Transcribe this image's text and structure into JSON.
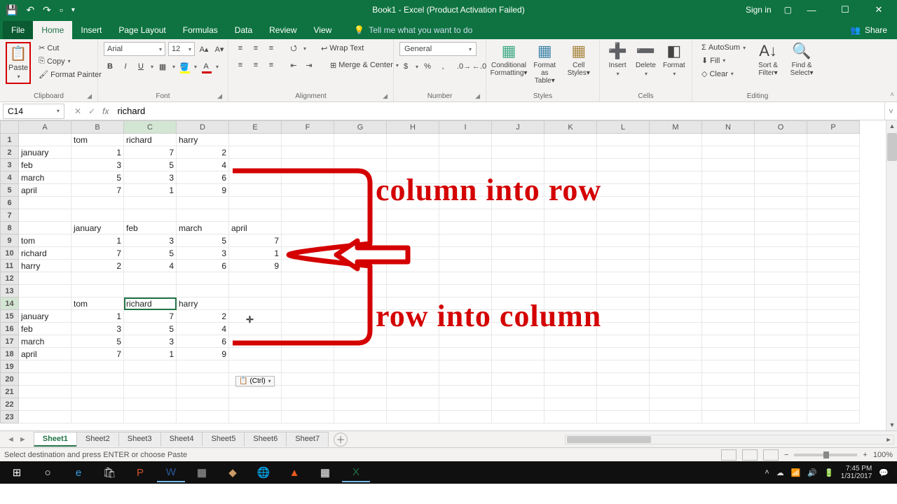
{
  "title": "Book1  -  Excel (Product Activation Failed)",
  "signin": "Sign in",
  "tabs": {
    "file": "File",
    "home": "Home",
    "insert": "Insert",
    "pagelayout": "Page Layout",
    "formulas": "Formulas",
    "data": "Data",
    "review": "Review",
    "view": "View",
    "tellme": "Tell me what you want to do",
    "share": "Share"
  },
  "ribbon": {
    "clipboard": {
      "paste": "Paste",
      "cut": "Cut",
      "copy": "Copy",
      "fmtpainter": "Format Painter",
      "label": "Clipboard"
    },
    "font": {
      "name": "Arial",
      "size": "12",
      "b": "B",
      "i": "I",
      "u": "U",
      "label": "Font"
    },
    "alignment": {
      "wrap": "Wrap Text",
      "merge": "Merge & Center",
      "label": "Alignment"
    },
    "number": {
      "fmt": "General",
      "label": "Number"
    },
    "styles": {
      "cond": "Conditional Formatting",
      "table": "Format as Table",
      "cell": "Cell Styles",
      "label": "Styles"
    },
    "cells": {
      "insert": "Insert",
      "delete": "Delete",
      "format": "Format",
      "label": "Cells"
    },
    "editing": {
      "sum": "AutoSum",
      "fill": "Fill",
      "clear": "Clear",
      "sort": "Sort & Filter",
      "find": "Find & Select",
      "label": "Editing"
    }
  },
  "namebox": "C14",
  "formula": "richard",
  "columns": [
    "A",
    "B",
    "C",
    "D",
    "E",
    "F",
    "G",
    "H",
    "I",
    "J",
    "K",
    "L",
    "M",
    "N",
    "O",
    "P"
  ],
  "cells": {
    "r1": {
      "B": "tom",
      "C": "richard",
      "D": "harry"
    },
    "r2": {
      "A": "january",
      "B": "1",
      "C": "7",
      "D": "2"
    },
    "r3": {
      "A": "feb",
      "B": "3",
      "C": "5",
      "D": "4"
    },
    "r4": {
      "A": "march",
      "B": "5",
      "C": "3",
      "D": "6"
    },
    "r5": {
      "A": "april",
      "B": "7",
      "C": "1",
      "D": "9"
    },
    "r8": {
      "B": "january",
      "C": "feb",
      "D": "march",
      "E": "april"
    },
    "r9": {
      "A": "tom",
      "B": "1",
      "C": "3",
      "D": "5",
      "E": "7"
    },
    "r10": {
      "A": "richard",
      "B": "7",
      "C": "5",
      "D": "3",
      "E": "1"
    },
    "r11": {
      "A": "harry",
      "B": "2",
      "C": "4",
      "D": "6",
      "E": "9"
    },
    "r14": {
      "B": "tom",
      "C": "richard",
      "D": "harry"
    },
    "r15": {
      "A": "january",
      "B": "1",
      "C": "7",
      "D": "2"
    },
    "r16": {
      "A": "feb",
      "B": "3",
      "C": "5",
      "D": "4"
    },
    "r17": {
      "A": "march",
      "B": "5",
      "C": "3",
      "D": "6"
    },
    "r18": {
      "A": "april",
      "B": "7",
      "C": "1",
      "D": "9"
    }
  },
  "paste_opts": "(Ctrl)",
  "annotations": {
    "top": "column into row",
    "bottom": "row into column"
  },
  "sheets": [
    "Sheet1",
    "Sheet2",
    "Sheet3",
    "Sheet4",
    "Sheet5",
    "Sheet6",
    "Sheet7"
  ],
  "status": "Select destination and press ENTER or choose Paste",
  "zoom": "100%",
  "clock": {
    "time": "7:45 PM",
    "date": "1/31/2017"
  }
}
